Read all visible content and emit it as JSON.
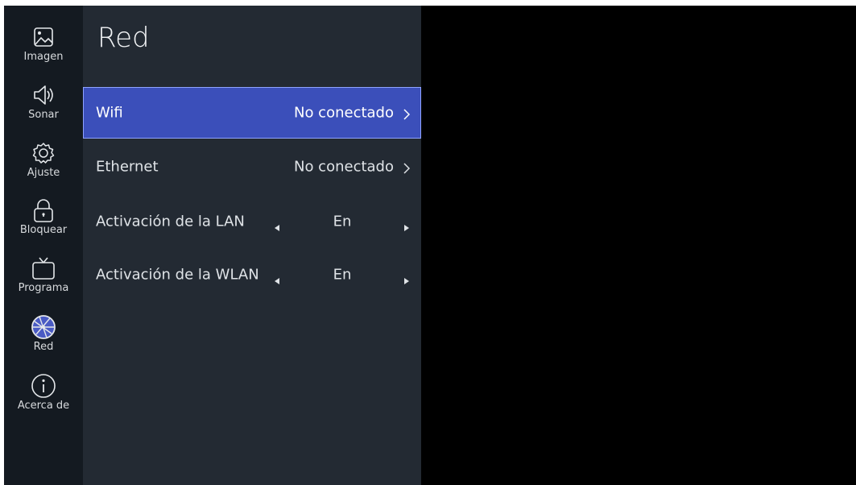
{
  "sidebar": {
    "items": [
      {
        "label": "Imagen",
        "icon": "image-icon"
      },
      {
        "label": "Sonar",
        "icon": "speaker-icon"
      },
      {
        "label": "Ajuste",
        "icon": "gear-icon"
      },
      {
        "label": "Bloquear",
        "icon": "lock-icon"
      },
      {
        "label": "Programa",
        "icon": "tv-icon"
      },
      {
        "label": "Red",
        "icon": "globe-icon"
      },
      {
        "label": "Acerca de",
        "icon": "info-icon"
      }
    ]
  },
  "panel": {
    "title": "Red",
    "rows": [
      {
        "label": "Wifi",
        "value": "No conectado"
      },
      {
        "label": "Ethernet",
        "value": "No conectado"
      },
      {
        "label": "Activación de la LAN",
        "value": "En"
      },
      {
        "label": "Activación de la WLAN",
        "value": "En"
      }
    ]
  },
  "colors": {
    "sidebar_bg": "#141a21",
    "panel_bg": "#232a33",
    "selected_bg": "#3b4fba",
    "selected_border": "#8fa3ff",
    "text": "#dfe3e7",
    "screen_bg": "#000000"
  }
}
